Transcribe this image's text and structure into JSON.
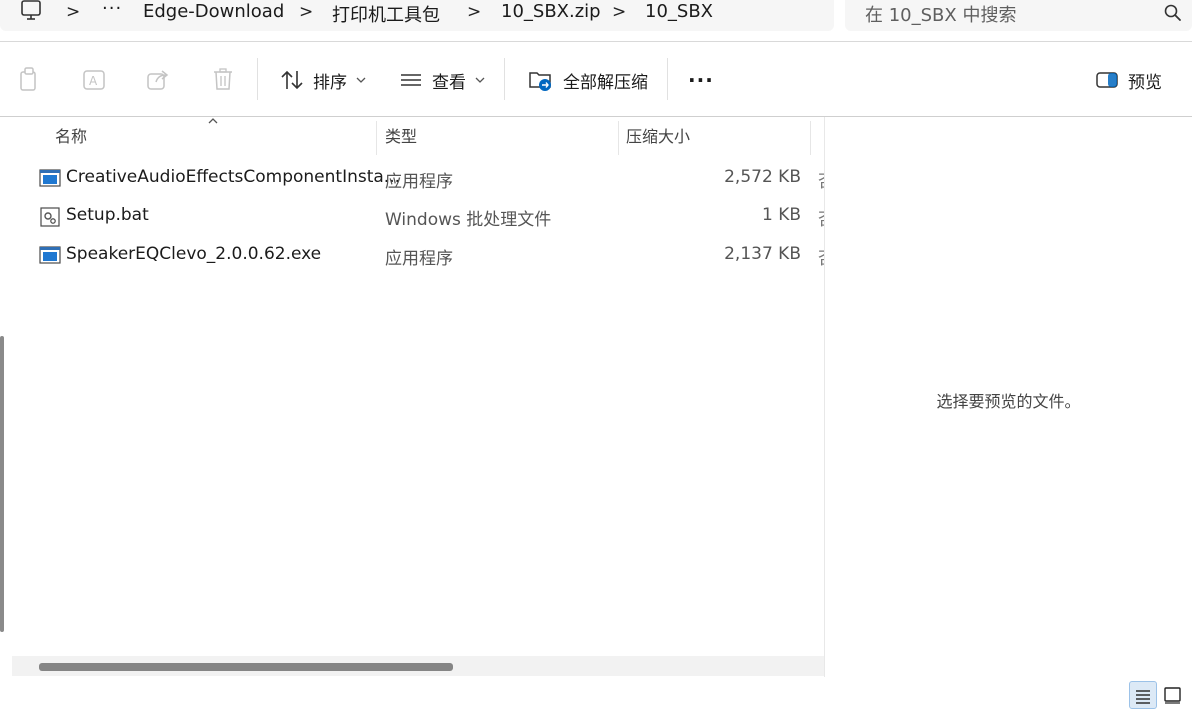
{
  "address_bar": {
    "more": "···",
    "sep": ">",
    "crumbs": [
      "Edge-Download",
      "打印机工具包",
      "10_SBX.zip",
      "10_SBX"
    ]
  },
  "search": {
    "placeholder": "在 10_SBX 中搜索"
  },
  "toolbar": {
    "sort_label": "排序",
    "view_label": "查看",
    "extract_all_label": "全部解压缩",
    "more_label": "···",
    "preview_label": "预览"
  },
  "columns": {
    "name": "名称",
    "type": "类型",
    "compressed_size": "压缩大小"
  },
  "files": [
    {
      "name": "CreativeAudioEffectsComponentInsta...",
      "type": "应用程序",
      "size": "2,572 KB",
      "icon": "application-icon"
    },
    {
      "name": "Setup.bat",
      "type": "Windows 批处理文件",
      "size": "1 KB",
      "icon": "batch-file-icon"
    },
    {
      "name": "SpeakerEQClevo_2.0.0.62.exe",
      "type": "应用程序",
      "size": "2,137 KB",
      "icon": "application-icon"
    }
  ],
  "preview": {
    "empty_message": "选择要预览的文件。"
  },
  "colors": {
    "accent": "#0067c0",
    "scroll_thumb": "#858585",
    "selected_view": "#dce9f6"
  }
}
